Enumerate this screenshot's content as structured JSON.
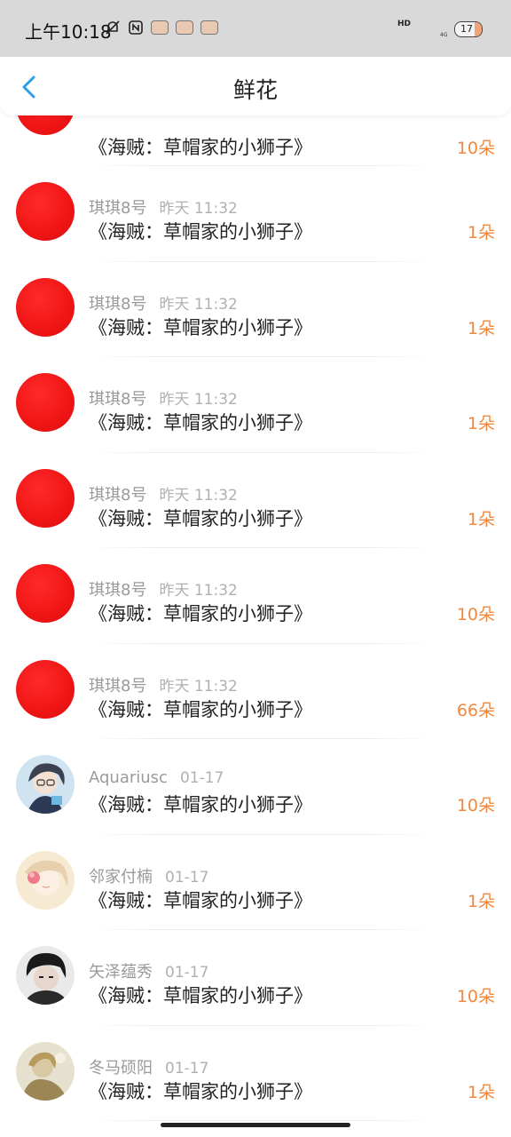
{
  "status_bar": {
    "time": "上午10:18",
    "hd": "HD",
    "network": "4G",
    "battery": "17"
  },
  "header": {
    "title": "鲜花"
  },
  "gifts": [
    {
      "user": "",
      "time": "",
      "title": "《海贼：草帽家的小狮子》",
      "count": "10朵",
      "avatar": "red"
    },
    {
      "user": "琪琪8号",
      "time": "昨天 11:32",
      "title": "《海贼：草帽家的小狮子》",
      "count": "1朵",
      "avatar": "red"
    },
    {
      "user": "琪琪8号",
      "time": "昨天 11:32",
      "title": "《海贼：草帽家的小狮子》",
      "count": "1朵",
      "avatar": "red"
    },
    {
      "user": "琪琪8号",
      "time": "昨天 11:32",
      "title": "《海贼：草帽家的小狮子》",
      "count": "1朵",
      "avatar": "red"
    },
    {
      "user": "琪琪8号",
      "time": "昨天 11:32",
      "title": "《海贼：草帽家的小狮子》",
      "count": "1朵",
      "avatar": "red"
    },
    {
      "user": "琪琪8号",
      "time": "昨天 11:32",
      "title": "《海贼：草帽家的小狮子》",
      "count": "10朵",
      "avatar": "red"
    },
    {
      "user": "琪琪8号",
      "time": "昨天 11:32",
      "title": "《海贼：草帽家的小狮子》",
      "count": "66朵",
      "avatar": "red"
    },
    {
      "user": "Aquariusc",
      "time": "01-17",
      "title": "《海贼：草帽家的小狮子》",
      "count": "10朵",
      "avatar": "anime-boy"
    },
    {
      "user": "邻家付楠",
      "time": "01-17",
      "title": "《海贼：草帽家的小狮子》",
      "count": "1朵",
      "avatar": "flower-girl"
    },
    {
      "user": "矢泽蕴秀",
      "time": "01-17",
      "title": "《海贼：草帽家的小狮子》",
      "count": "10朵",
      "avatar": "dark-hair-boy"
    },
    {
      "user": "冬马硕阳",
      "time": "01-17",
      "title": "《海贼：草帽家的小狮子》",
      "count": "1朵",
      "avatar": "sepia-figure"
    }
  ],
  "colors": {
    "count_orange": "#f0883e",
    "avatar_red": "#f01515",
    "back_blue": "#2e9fe6"
  }
}
